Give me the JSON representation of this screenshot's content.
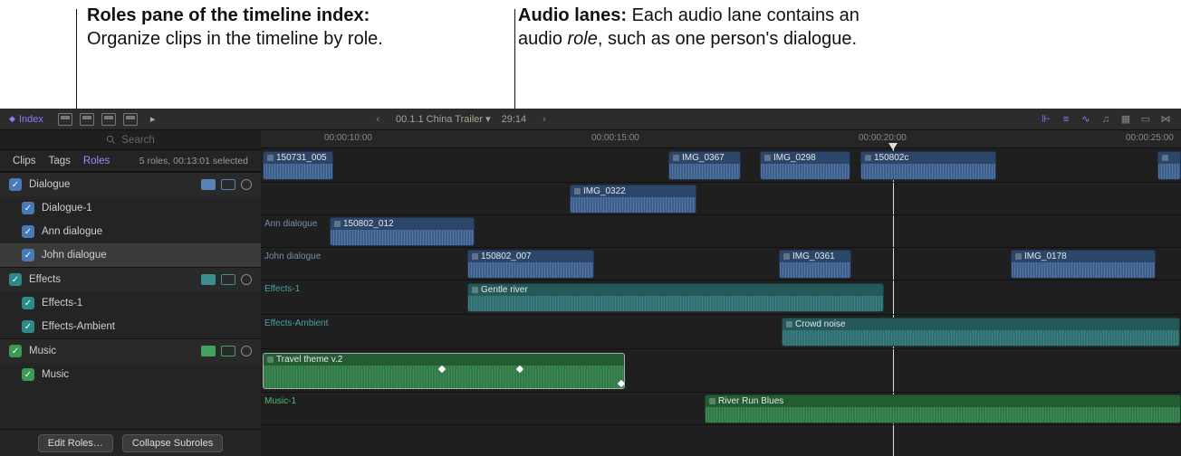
{
  "callouts": {
    "roles_pane_bold": "Roles pane of the timeline index:",
    "roles_pane_rest": " Organize clips in the timeline by role.",
    "audio_lanes_bold": "Audio lanes:",
    "audio_lanes_rest_1": " Each audio lane contains an audio ",
    "audio_lanes_italic": "role",
    "audio_lanes_rest_2": ", such as one person's dialogue."
  },
  "toolbar": {
    "index_label": "Index",
    "project_name": "00.1.1 China Trailer",
    "project_caret": "▾",
    "project_time": "29:14"
  },
  "search_placeholder": "Search",
  "index_tabs": {
    "clips": "Clips",
    "tags": "Tags",
    "roles": "Roles",
    "status": "5 roles, 00:13:01 selected"
  },
  "roles": {
    "dialogue": {
      "label": "Dialogue",
      "subs": [
        "Dialogue-1",
        "Ann dialogue",
        "John dialogue"
      ]
    },
    "effects": {
      "label": "Effects",
      "subs": [
        "Effects-1",
        "Effects-Ambient"
      ]
    },
    "music": {
      "label": "Music",
      "subs": [
        "Music"
      ]
    }
  },
  "bottom": {
    "edit_roles": "Edit Roles…",
    "collapse": "Collapse Subroles"
  },
  "ruler": {
    "t0": "00:00:10:00",
    "t1": "00:00:15:00",
    "t2": "00:00:20:00",
    "t3": "00:00:25:00"
  },
  "lanes": {
    "ann": "Ann dialogue",
    "john": "John dialogue",
    "fx1": "Effects-1",
    "fxamb": "Effects-Ambient",
    "mus1": "Music-1"
  },
  "clips": {
    "c1": "150731_005",
    "c2": "IMG_0367",
    "c3": "IMG_0298",
    "c4": "150802c",
    "c5": "IMG_0322",
    "c6": "150802_012",
    "c7": "150802_007",
    "c8": "IMG_0361",
    "c9": "IMG_0178",
    "c10": "Gentle river",
    "c11": "Crowd noise",
    "c12": "Travel theme v.2",
    "c13": "River Run Blues"
  }
}
